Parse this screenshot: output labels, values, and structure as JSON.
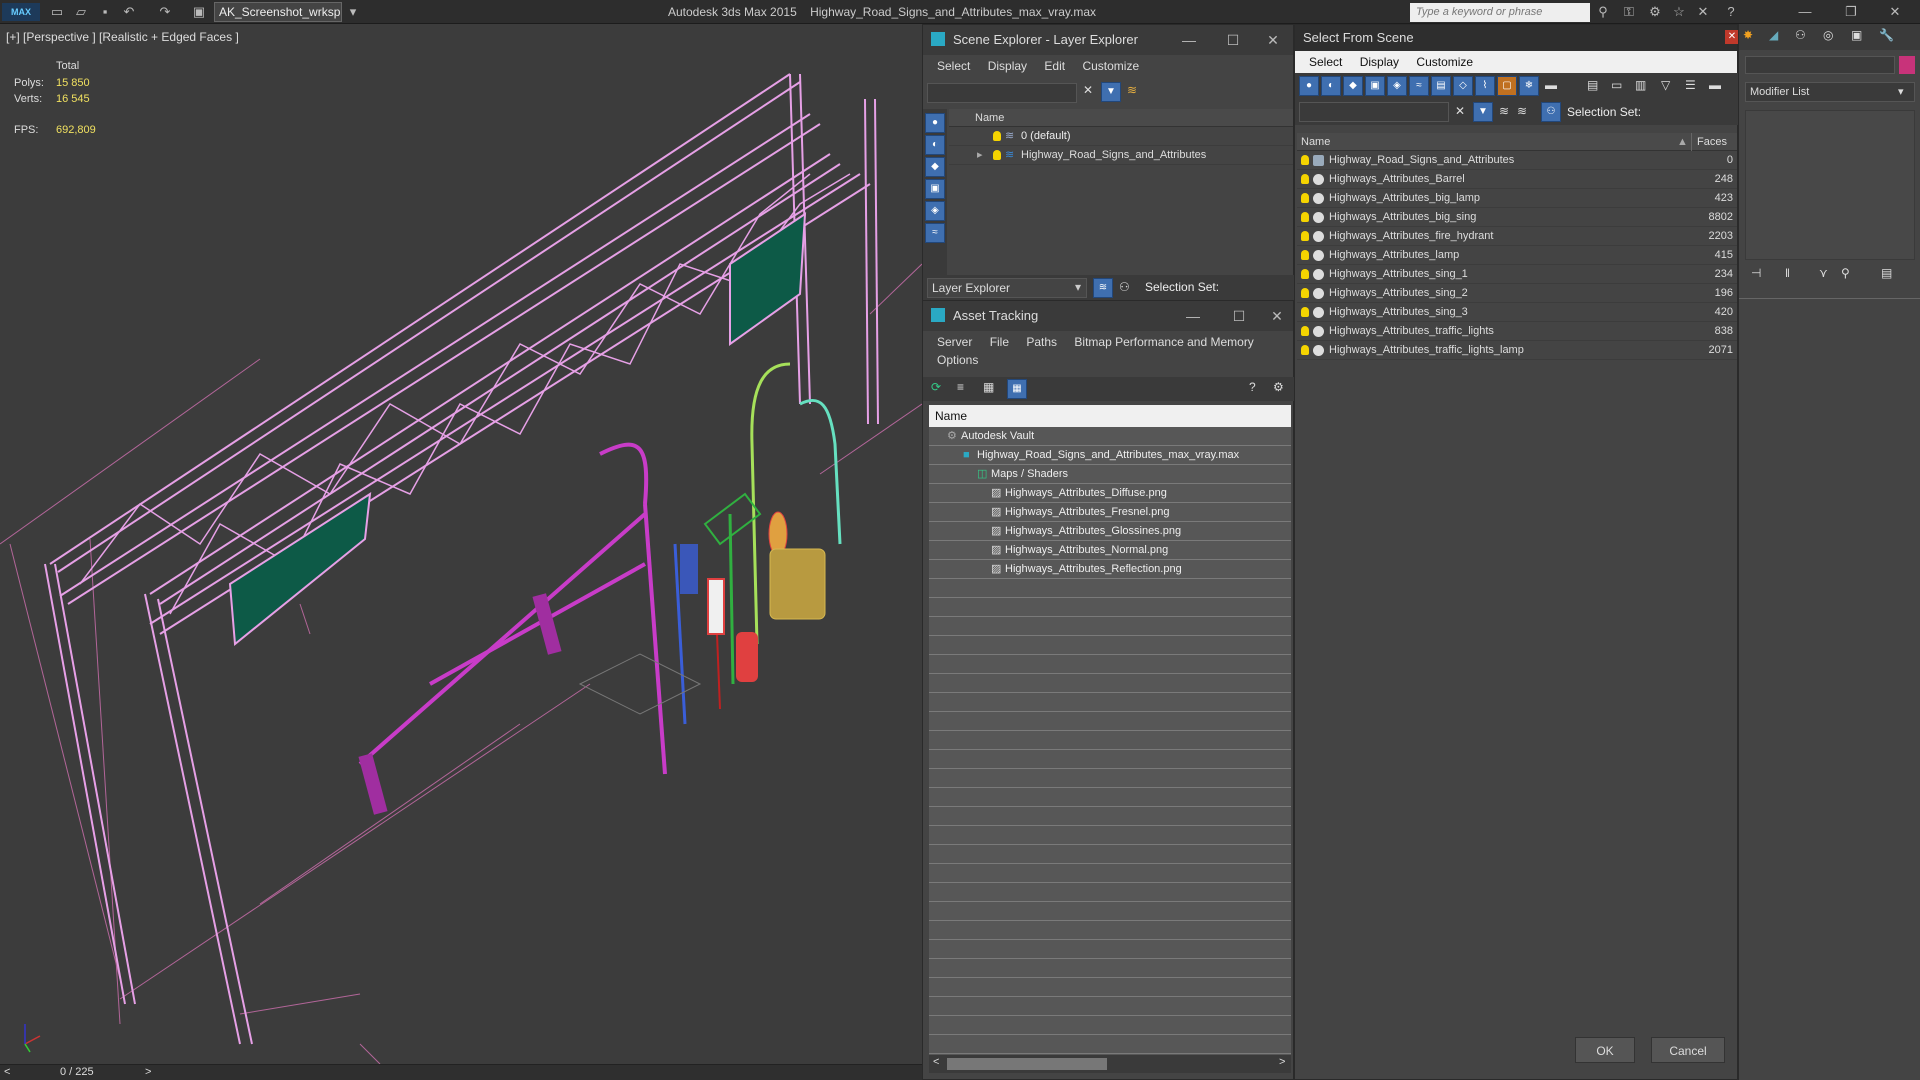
{
  "titlebar": {
    "logo": "MAX",
    "workspace": "AK_Screenshot_wrksp",
    "app_name": "Autodesk 3ds Max  2015",
    "file_name": "Highway_Road_Signs_and_Attributes_max_vray.max",
    "search_placeholder": "Type a keyword or phrase",
    "icons": [
      "new-file-icon",
      "open-folder-icon",
      "save-icon",
      "undo-icon",
      "redo-icon",
      "project-icon",
      "binoculars-icon",
      "key-icon",
      "subscription-icon",
      "star-icon",
      "close-x-icon",
      "help-icon",
      "minimize-icon",
      "restore-icon",
      "close-icon"
    ]
  },
  "viewport": {
    "label": "[+] [Perspective ] [Realistic + Edged Faces ]",
    "stats": {
      "total_label": "Total",
      "polys_label": "Polys:",
      "polys_value": "15 850",
      "verts_label": "Verts:",
      "verts_value": "16 545",
      "fps_label": "FPS:",
      "fps_value": "692,809"
    },
    "colors": {
      "truss": "#e6a0e6",
      "green_sign": "#0d5a47",
      "magenta": "#c83cc8",
      "cyan_lamp": "#66e0c0",
      "lime_lamp": "#a6e05a",
      "blue_pole": "#3a5ed8",
      "red": "#e04040",
      "barrel": "#b89a40"
    }
  },
  "timeline": {
    "frame": "0 / 225",
    "prev": "<",
    "next": ">"
  },
  "scene_explorer": {
    "title": "Scene Explorer - Layer Explorer",
    "menu": [
      "Select",
      "Display",
      "Edit",
      "Customize"
    ],
    "col_name": "Name",
    "layers": [
      {
        "name": "0 (default)"
      },
      {
        "name": "Highway_Road_Signs_and_Attributes"
      }
    ],
    "dropdown": "Layer Explorer",
    "selection_set_label": "Selection Set:"
  },
  "asset_tracking": {
    "title": "Asset Tracking",
    "menu": [
      "Server",
      "File",
      "Paths",
      "Bitmap Performance and Memory",
      "Options"
    ],
    "col_name": "Name",
    "tree": [
      {
        "label": "Autodesk Vault",
        "level": 1
      },
      {
        "label": "Highway_Road_Signs_and_Attributes_max_vray.max",
        "level": 2
      },
      {
        "label": "Maps / Shaders",
        "level": 3
      },
      {
        "label": "Highways_Attributes_Diffuse.png",
        "level": 4
      },
      {
        "label": "Highways_Attributes_Fresnel.png",
        "level": 4
      },
      {
        "label": "Highways_Attributes_Glossines.png",
        "level": 4
      },
      {
        "label": "Highways_Attributes_Normal.png",
        "level": 4
      },
      {
        "label": "Highways_Attributes_Reflection.png",
        "level": 4
      }
    ]
  },
  "select_from_scene": {
    "title": "Select From Scene",
    "menu": [
      "Select",
      "Display",
      "Customize"
    ],
    "selection_set_label": "Selection Set:",
    "col_name": "Name",
    "col_faces": "Faces",
    "rows": [
      {
        "name": "Highway_Road_Signs_and_Attributes",
        "faces": "0"
      },
      {
        "name": "Highways_Attributes_Barrel",
        "faces": "248"
      },
      {
        "name": "Highways_Attributes_big_lamp",
        "faces": "423"
      },
      {
        "name": "Highways_Attributes_big_sing",
        "faces": "8802"
      },
      {
        "name": "Highways_Attributes_fire_hydrant",
        "faces": "2203"
      },
      {
        "name": "Highways_Attributes_lamp",
        "faces": "415"
      },
      {
        "name": "Highways_Attributes_sing_1",
        "faces": "234"
      },
      {
        "name": "Highways_Attributes_sing_2",
        "faces": "196"
      },
      {
        "name": "Highways_Attributes_sing_3",
        "faces": "420"
      },
      {
        "name": "Highways_Attributes_traffic_lights",
        "faces": "838"
      },
      {
        "name": "Highways_Attributes_traffic_lights_lamp",
        "faces": "2071"
      }
    ],
    "ok": "OK",
    "cancel": "Cancel"
  },
  "command_panel": {
    "modifier_list": "Modifier List"
  }
}
